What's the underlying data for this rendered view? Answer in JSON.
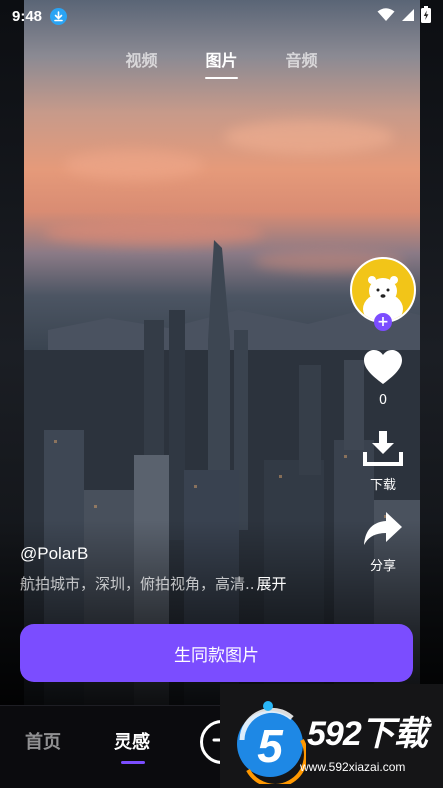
{
  "status_bar": {
    "time": "9:48",
    "icons": [
      "download-badge-icon",
      "wifi-icon",
      "signal-icon",
      "battery-charging-icon"
    ]
  },
  "top_tabs": [
    {
      "label": "视频",
      "active": false
    },
    {
      "label": "图片",
      "active": true
    },
    {
      "label": "音频",
      "active": false
    }
  ],
  "rail": {
    "avatar_icon": "polar-bear-avatar",
    "follow_icon": "plus-icon",
    "like_icon": "heart-icon",
    "like_count": "0",
    "download_icon": "download-icon",
    "download_label": "下载",
    "share_icon": "share-arrow-icon",
    "share_label": "分享"
  },
  "post": {
    "author": "@PolarB",
    "description": "航拍城市，深圳，俯拍视角，高清..",
    "expand_label": "展开"
  },
  "cta": {
    "label": "生同款图片"
  },
  "bottom_nav": {
    "items": [
      {
        "label": "首页",
        "active": false
      },
      {
        "label": "灵感",
        "active": true
      }
    ],
    "create_icon": "plus-circle-icon"
  },
  "watermark": {
    "brand": "592下载",
    "url": "www.592xiazai.com",
    "logo_glyph": "5"
  },
  "colors": {
    "accent": "#7b4dff",
    "download_badge": "#2aa4f4",
    "avatar_bg": "#f2c518"
  }
}
